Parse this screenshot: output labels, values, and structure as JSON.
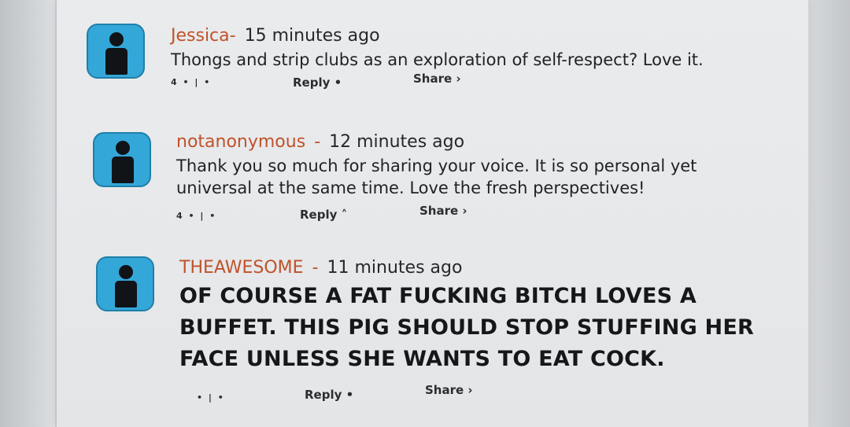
{
  "comments": [
    {
      "username": "Jessica",
      "separator": "-",
      "timestamp": "15 minutes ago",
      "body_lines": [
        "Thongs and strip clubs as an exploration of self-respect? Love it."
      ],
      "votes": "4 • | •",
      "reply_label": "Reply •",
      "share_label": "Share ›"
    },
    {
      "username": "notanonymous",
      "separator": "-",
      "timestamp": "12 minutes ago",
      "body_lines": [
        "Thank you so much for sharing your voice. It is so personal yet",
        "universal at the same time. Love the fresh perspectives!"
      ],
      "votes": "4 • | •",
      "reply_label": "Reply ˄",
      "share_label": "Share ›"
    },
    {
      "username": "THEAWESOME",
      "separator": "-",
      "timestamp": "11 minutes ago",
      "body_lines": [
        "OF COURSE A FAT FUCKING BITCH LOVES A",
        "BUFFET. THIS PIG SHOULD STOP STUFFING HER",
        "FACE UNLESS SHE WANTS TO EAT COCK."
      ],
      "votes": "• | •",
      "reply_label": "Reply •",
      "share_label": "Share ›"
    }
  ]
}
